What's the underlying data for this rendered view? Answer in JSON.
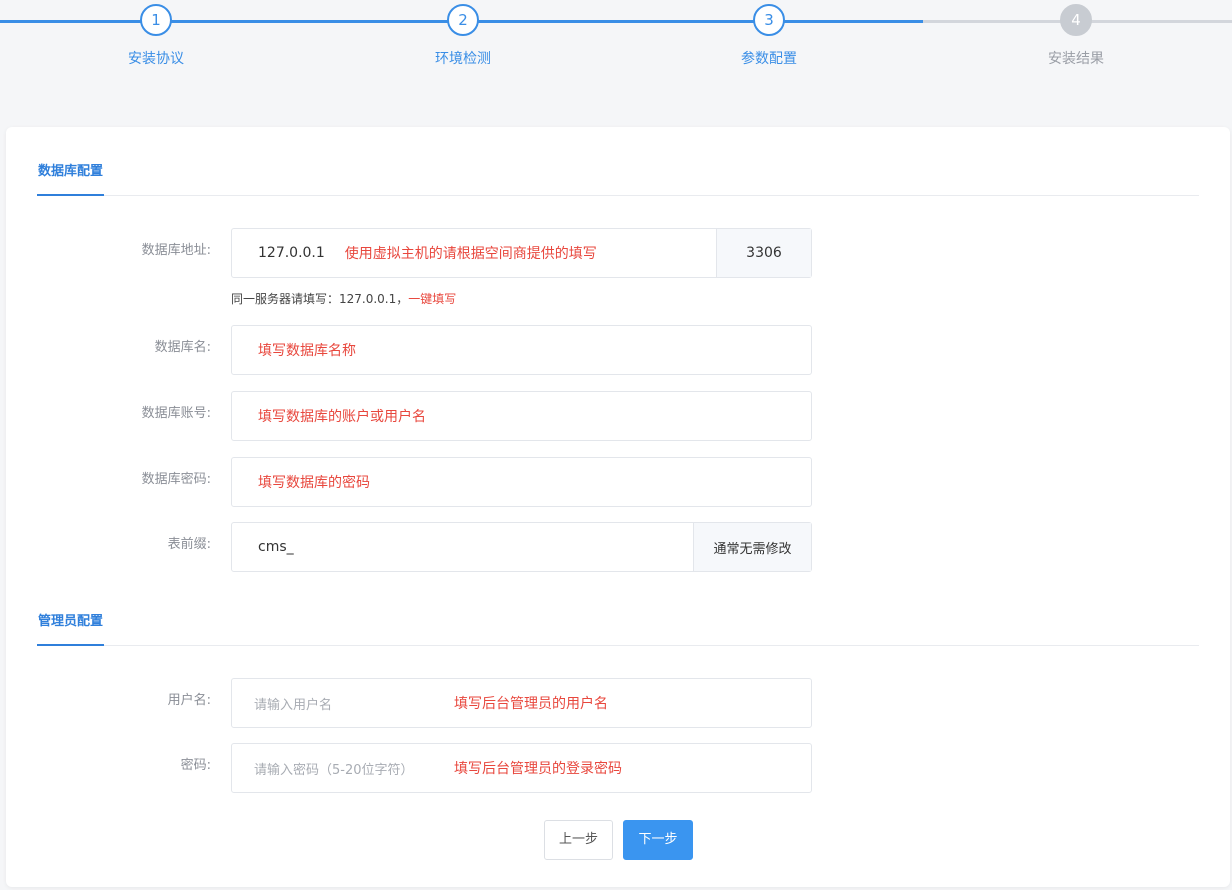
{
  "stepper": {
    "steps": [
      {
        "number": "1",
        "title": "安装协议",
        "state": "done"
      },
      {
        "number": "2",
        "title": "环境检测",
        "state": "done"
      },
      {
        "number": "3",
        "title": "参数配置",
        "state": "active"
      },
      {
        "number": "4",
        "title": "安装结果",
        "state": "todo"
      }
    ]
  },
  "db_section": {
    "title": "数据库配置",
    "host": {
      "label": "数据库地址:",
      "value": "127.0.0.1",
      "hint": "使用虚拟主机的请根据空间商提供的填写",
      "port": "3306"
    },
    "tip": {
      "text": "同一服务器请填写：127.0.0.1，",
      "link": "一键填写"
    },
    "name": {
      "label": "数据库名:",
      "hint": "填写数据库名称"
    },
    "account": {
      "label": "数据库账号:",
      "hint": "填写数据库的账户或用户名"
    },
    "password": {
      "label": "数据库密码:",
      "hint": "填写数据库的密码"
    },
    "prefix": {
      "label": "表前缀:",
      "value": "cms_",
      "addon": "通常无需修改"
    }
  },
  "admin_section": {
    "title": "管理员配置",
    "username": {
      "label": "用户名:",
      "placeholder": "请输入用户名",
      "hint": "填写后台管理员的用户名"
    },
    "password": {
      "label": "密码:",
      "placeholder": "请输入密码（5-20位字符）",
      "hint": "填写后台管理员的登录密码"
    }
  },
  "buttons": {
    "prev": "上一步",
    "next": "下一步"
  },
  "colors": {
    "accent": "#3a8ee6",
    "hint_red": "#e8473d",
    "inactive": "#c8ccd2"
  }
}
